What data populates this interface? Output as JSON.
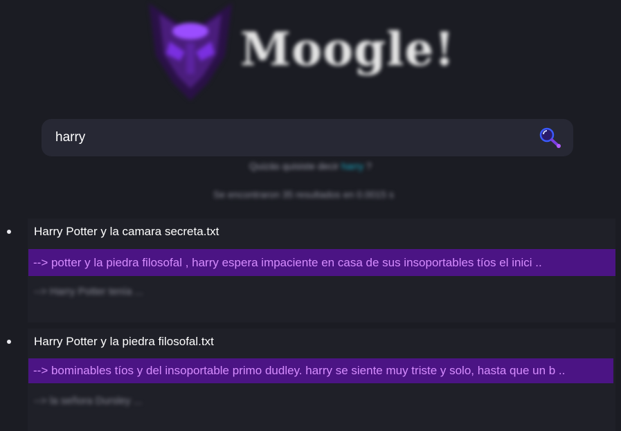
{
  "logo": {
    "text": "Moogle!",
    "icon": "purple-mask-logo-icon"
  },
  "search": {
    "value": "harry",
    "button_icon": "magnifier-search-icon"
  },
  "suggestion": {
    "prefix": "Quizás quisiste decir",
    "term": "harry",
    "suffix": "?"
  },
  "results_info": "Se encontraron 35 resultados en 0.0015 s",
  "results": [
    {
      "title": "Harry Potter y la camara secreta.txt",
      "snippet": "--> potter y la piedra filosofal , harry espera impaciente en casa de sus insoportables tíos el inici ..",
      "extra_snippet": "--> Harry Potter tenía ..."
    },
    {
      "title": "Harry Potter y la piedra filosofal.txt",
      "snippet": "--> bominables tíos y del insoportable primo dudley. harry se siente muy triste y solo, hasta que un b ..",
      "extra_snippet": "--> la señora Dursley ..."
    }
  ],
  "colors": {
    "background": "#1b1c23",
    "card": "#1f2028",
    "search_box": "#272834",
    "snippet_bg": "#4b1484",
    "snippet_text": "#d68cff",
    "accent_cyan": "#19a9c4"
  }
}
